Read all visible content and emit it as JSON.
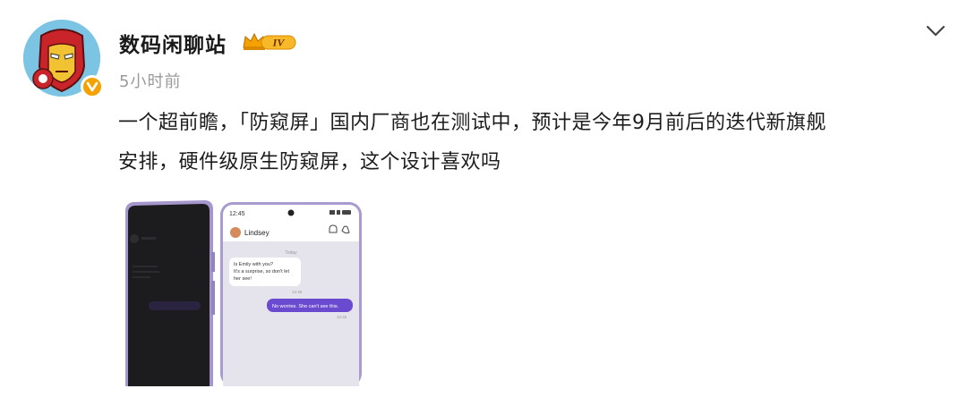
{
  "post": {
    "author": "数码闲聊站",
    "level_badge": "IV",
    "time": "5小时前",
    "content_line1": "一个超前瞻，「防窥屏」国内厂商也在测试中，预计是今年9月前后的迭代新旗舰",
    "content_line2": "安排，硬件级原生防窥屏，这个设计喜欢吗"
  },
  "phone_screen": {
    "status_time": "12:45",
    "contact_name": "Lindsey",
    "date_label": "Today",
    "incoming_message_line1": "Is Emily with you?",
    "incoming_message_line2": "It's a surprise, so don't let",
    "incoming_message_line3": "her see!",
    "incoming_time": "12:45",
    "outgoing_message": "No worries. She can't see this.",
    "outgoing_time": "12:45"
  },
  "colors": {
    "accent_orange": "#f5a200",
    "outgoing_bubble": "#6a4bd0",
    "phone_frame": "#a99bd0"
  },
  "icons": {
    "verify": "v-badge-icon",
    "more": "chevron-down-icon"
  }
}
